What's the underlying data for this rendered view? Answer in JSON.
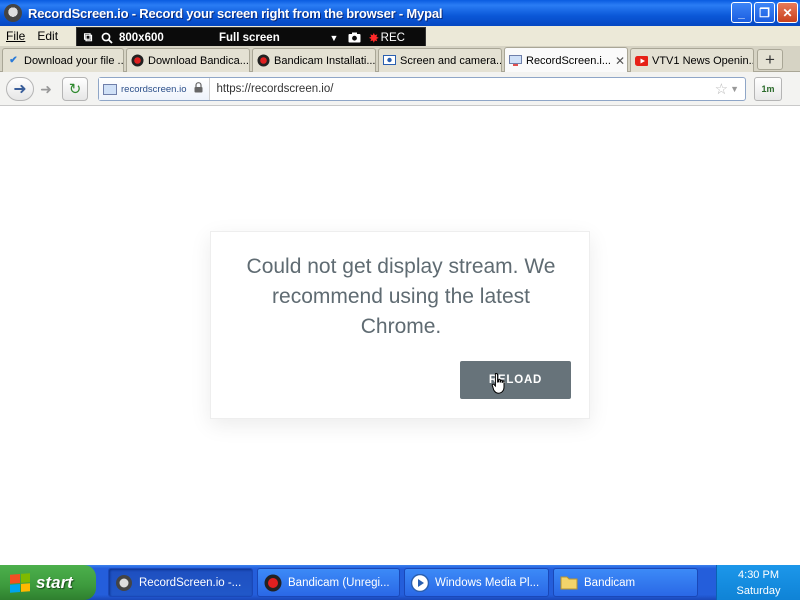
{
  "window": {
    "title": "RecordScreen.io - Record your screen right from the browser - Mypal",
    "min_glyph": "_",
    "max_glyph": "❐",
    "close_glyph": "✕"
  },
  "menu": {
    "items": [
      "File",
      "Edit"
    ]
  },
  "bandicam": {
    "resolution": "800x600",
    "mode": "Full screen",
    "rec_label": "REC"
  },
  "tabs": [
    {
      "label": "Download your file ...",
      "icon": "check-icon",
      "active": false
    },
    {
      "label": "Download Bandica...",
      "icon": "bandicam-icon",
      "active": false
    },
    {
      "label": "Bandicam Installati...",
      "icon": "bandicam-icon",
      "active": false
    },
    {
      "label": "Screen and camera...",
      "icon": "screen-icon",
      "active": false
    },
    {
      "label": "RecordScreen.i...",
      "icon": "screen-icon",
      "active": true,
      "close": "✕"
    },
    {
      "label": "VTV1 News Openin...",
      "icon": "youtube-icon",
      "active": false
    }
  ],
  "new_tab_glyph": "+",
  "nav": {
    "site_identity": "recordscreen.io",
    "url": "https://recordscreen.io/",
    "addon_label": "1m"
  },
  "dialog": {
    "message": "Could not get display stream. We recommend using the latest Chrome.",
    "button_label": "RELOAD"
  },
  "taskbar": {
    "start_label": "start",
    "buttons": [
      {
        "label": "RecordScreen.io -...",
        "icon": "mypal-icon",
        "active": true
      },
      {
        "label": "Bandicam (Unregi...",
        "icon": "bandicam-icon",
        "active": false
      },
      {
        "label": "Windows Media Pl...",
        "icon": "media-player-icon",
        "active": false
      },
      {
        "label": "Bandicam",
        "icon": "folder-icon",
        "active": false
      }
    ],
    "clock_time": "4:30 PM",
    "clock_day": "Saturday"
  },
  "colors": {
    "titlebar": "#0b58d8",
    "dialog_text": "#5f6b72",
    "reload_button": "#67737a",
    "taskbar": "#245edb",
    "start_button": "#3d9a3d"
  }
}
